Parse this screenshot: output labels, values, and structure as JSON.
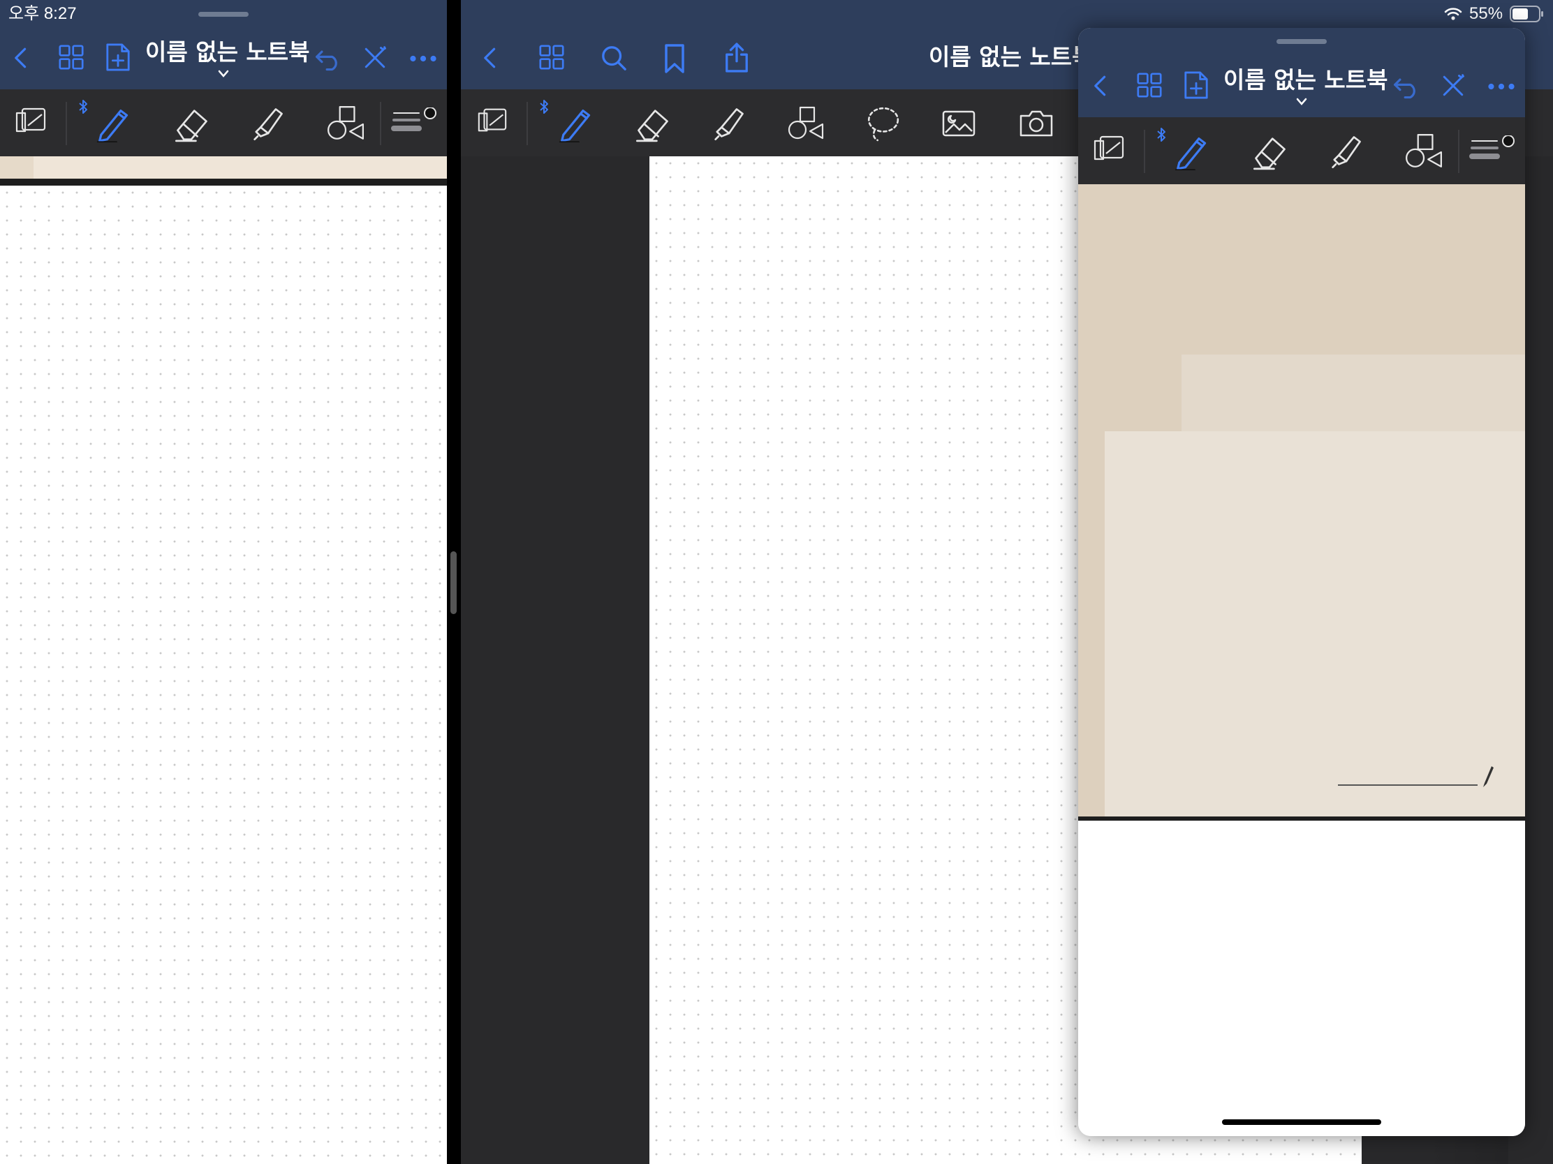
{
  "status_bar": {
    "time": "오후 8:27",
    "battery": "55%"
  },
  "left_pane": {
    "title": "이름 없는 노트북"
  },
  "middle_pane": {
    "title": "이름 없는 노트북"
  },
  "slide_over": {
    "title": "이름 없는 노트북"
  },
  "colors": {
    "nav_bar": "#2e3e5c",
    "toolbar": "#2c2c2e",
    "accent": "#3d7bf4",
    "paper": "#ffffff",
    "beige": "#ddd0be",
    "dark_gutter": "#29292b"
  },
  "icons": {
    "nav": [
      "back-icon",
      "grid-icon",
      "add-page-icon",
      "search-icon",
      "bookmark-icon",
      "share-icon",
      "undo-icon",
      "ruler-cross-icon",
      "more-icon"
    ],
    "tools": [
      "page-view-icon",
      "bluetooth-icon",
      "pen-icon",
      "eraser-icon",
      "highlighter-icon",
      "shapes-icon",
      "lasso-icon",
      "image-icon",
      "camera-icon",
      "stroke-size-icon"
    ]
  }
}
